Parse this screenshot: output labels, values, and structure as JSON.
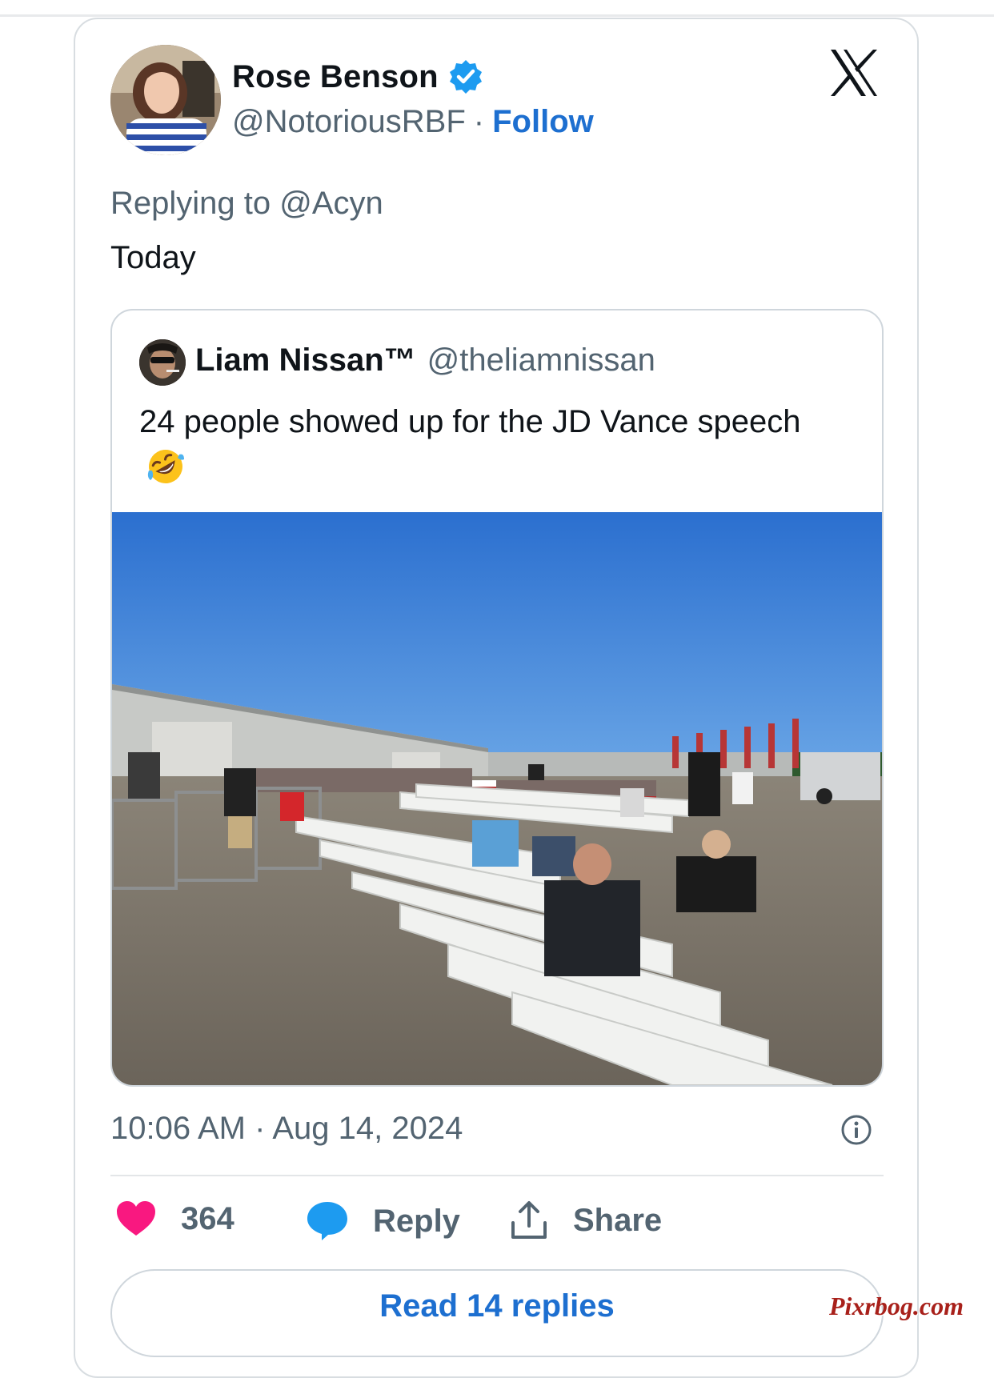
{
  "author": {
    "name": "Rose Benson",
    "handle": "@NotoriousRBF",
    "separator": "·",
    "follow_label": "Follow",
    "verified": true
  },
  "platform_icon": "x-logo-icon",
  "reply_context": "Replying to @Acyn",
  "tweet_text": "Today",
  "quoted_tweet": {
    "name": "Liam Nissan™",
    "handle": "@theliamnissan",
    "text": "24 people showed up for the JD Vance speech",
    "emoji": "rolling-on-floor-laughing-emoji",
    "media": "photo-rally-empty-chairs"
  },
  "timestamp": "10:06 AM · Aug 14, 2024",
  "actions": {
    "like_count": "364",
    "reply_label": "Reply",
    "share_label": "Share"
  },
  "read_replies_label": "Read 14 replies",
  "watermark": "Pixrbog.com",
  "colors": {
    "accent": "#1d6fd0",
    "like": "#f91880",
    "reply_bubble": "#1d9bf0",
    "muted_text": "#536471"
  }
}
